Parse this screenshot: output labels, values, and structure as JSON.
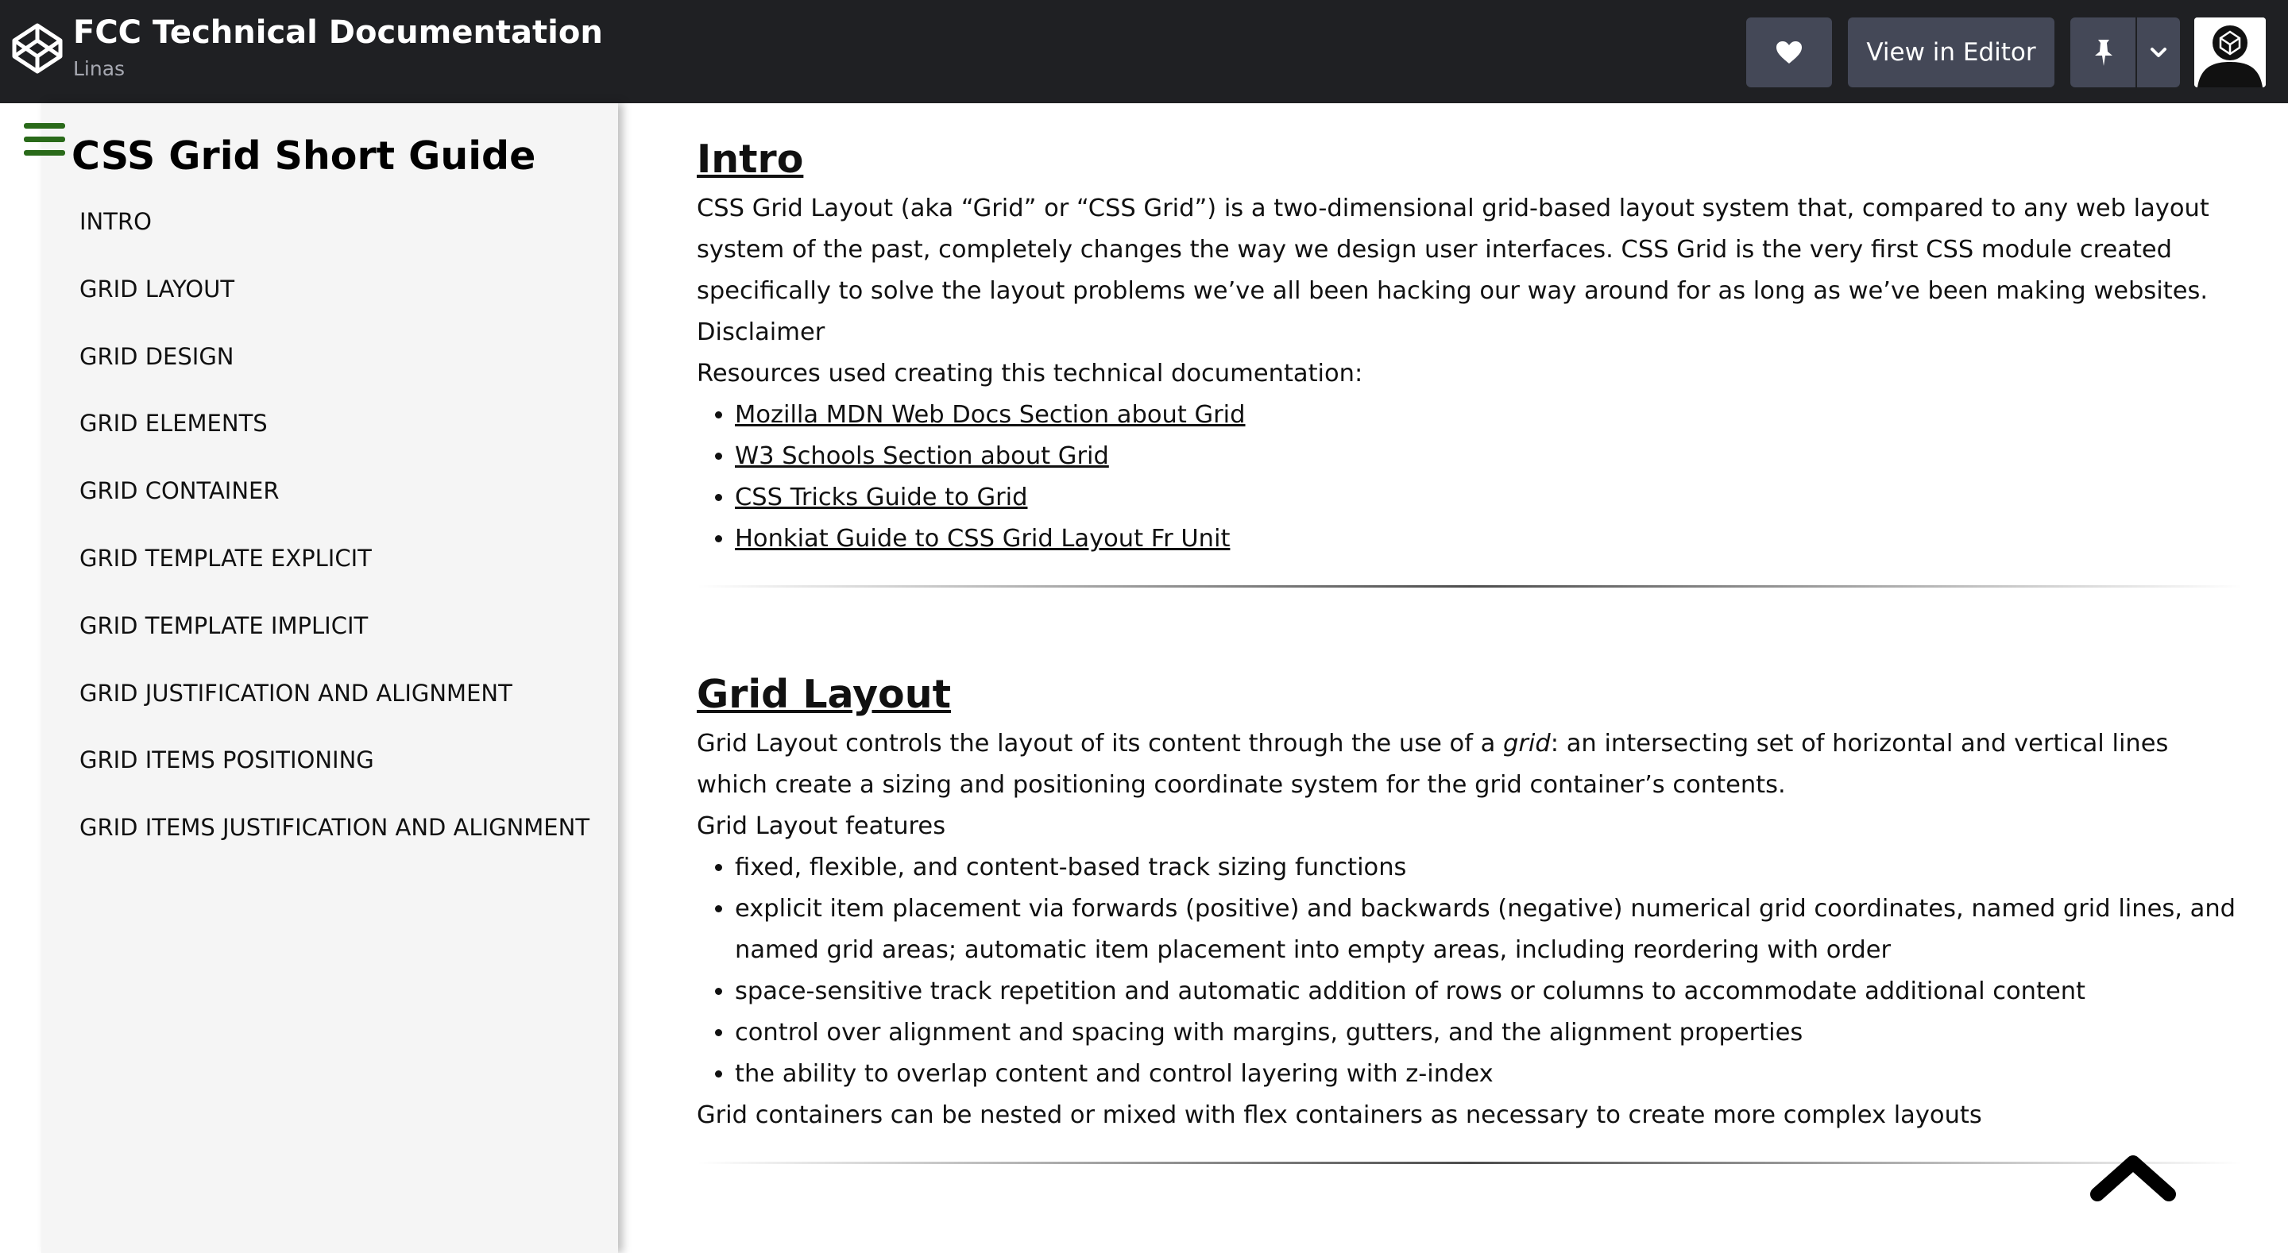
{
  "header": {
    "title": "FCC Technical Documentation",
    "author": "Linas",
    "editor_label": "View in Editor",
    "icons": [
      "codepen-logo-icon",
      "heart-icon",
      "pin-icon",
      "chevron-down-icon",
      "avatar"
    ]
  },
  "sidebar": {
    "title": "CSS Grid Short Guide",
    "items": [
      "INTRO",
      "GRID LAYOUT",
      "GRID DESIGN",
      "GRID ELEMENTS",
      "GRID CONTAINER",
      "GRID TEMPLATE EXPLICIT",
      "GRID TEMPLATE IMPLICIT",
      "GRID JUSTIFICATION AND ALIGNMENT",
      "GRID ITEMS POSITIONING",
      "GRID ITEMS JUSTIFICATION AND ALIGNMENT"
    ]
  },
  "intro": {
    "title": "Intro",
    "text": "CSS Grid Layout (aka “Grid” or “CSS Grid”) is a two-dimensional grid-based layout system that, compared to any web layout system of the past, completely changes the way we design user interfaces. CSS Grid is the very first CSS module created specifically to solve the layout problems we’ve all been hacking our way around for as long as we’ve been making websites.",
    "disclaimer": "Disclaimer",
    "resources_label": "Resources used creating this technical documentation:",
    "resources": [
      "Mozilla MDN Web Docs Section about Grid",
      "W3 Schools Section about Grid",
      "CSS Tricks Guide to Grid",
      "Honkiat Guide to CSS Grid Layout Fr Unit"
    ]
  },
  "grid_layout": {
    "title": "Grid Layout",
    "text_before": "Grid Layout controls the layout of its content through the use of a ",
    "text_em": "grid",
    "text_after": ": an intersecting set of horizontal and vertical lines which create a sizing and positioning coordinate system for the grid container’s contents.",
    "features_label": "Grid Layout features",
    "features": [
      "fixed, flexible, and content-based track sizing functions",
      "explicit item placement via forwards (positive) and backwards (negative) numerical grid coordinates, named grid lines, and named grid areas; automatic item placement into empty areas, including reordering with order",
      "space-sensitive track repetition and automatic addition of rows or columns to accommodate additional content",
      "control over alignment and spacing with margins, gutters, and the alignment properties",
      "the ability to overlap content and control layering with z-index"
    ],
    "closing": "Grid containers can be nested or mixed with flex containers as necessary to create more complex layouts"
  },
  "colors": {
    "topbar": "#1f2023",
    "button": "#444857",
    "sidebar": "#f5f5f5",
    "hamburger": "#2a6a1a"
  }
}
